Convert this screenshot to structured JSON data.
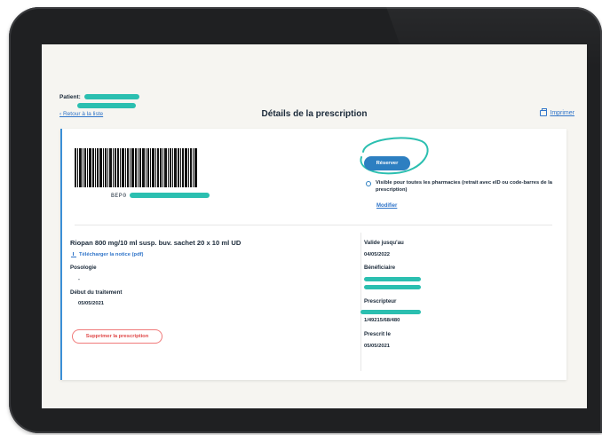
{
  "header": {
    "patient_label": "Patient:",
    "back_link": "‹ Retour à la liste",
    "page_title": "Détails de la prescription",
    "print_label": "Imprimer",
    "print_icon": "printer-icon"
  },
  "barcode": {
    "prefix": "BEP0"
  },
  "reservation": {
    "button_label": "Réserver",
    "visibility_text": "Visible pour toutes les pharmacies (retrait avec eID ou code-barres de la prescription)",
    "modify_label": "Modifier"
  },
  "medication": {
    "name": "Riopan 800 mg/10 ml susp. buv. sachet 20 x 10 ml UD",
    "notice_link": "Télécharger la notice (pdf)",
    "posologie_label": "Posologie",
    "posologie_value": "-",
    "start_label": "Début du traitement",
    "start_value": "05/05/2021",
    "delete_label": "Supprimer la prescription"
  },
  "details": {
    "valid_label": "Valide jusqu'au",
    "valid_value": "04/05/2022",
    "beneficiary_label": "Bénéficiaire",
    "prescriber_label": "Prescripteur",
    "prescriber_number": "1/49215/68/480",
    "prescribed_label": "Prescrit le",
    "prescribed_value": "05/05/2021"
  },
  "colors": {
    "accent_blue": "#2d7fc1",
    "redaction_teal": "#2bbfb0",
    "danger_red": "#e04848"
  }
}
